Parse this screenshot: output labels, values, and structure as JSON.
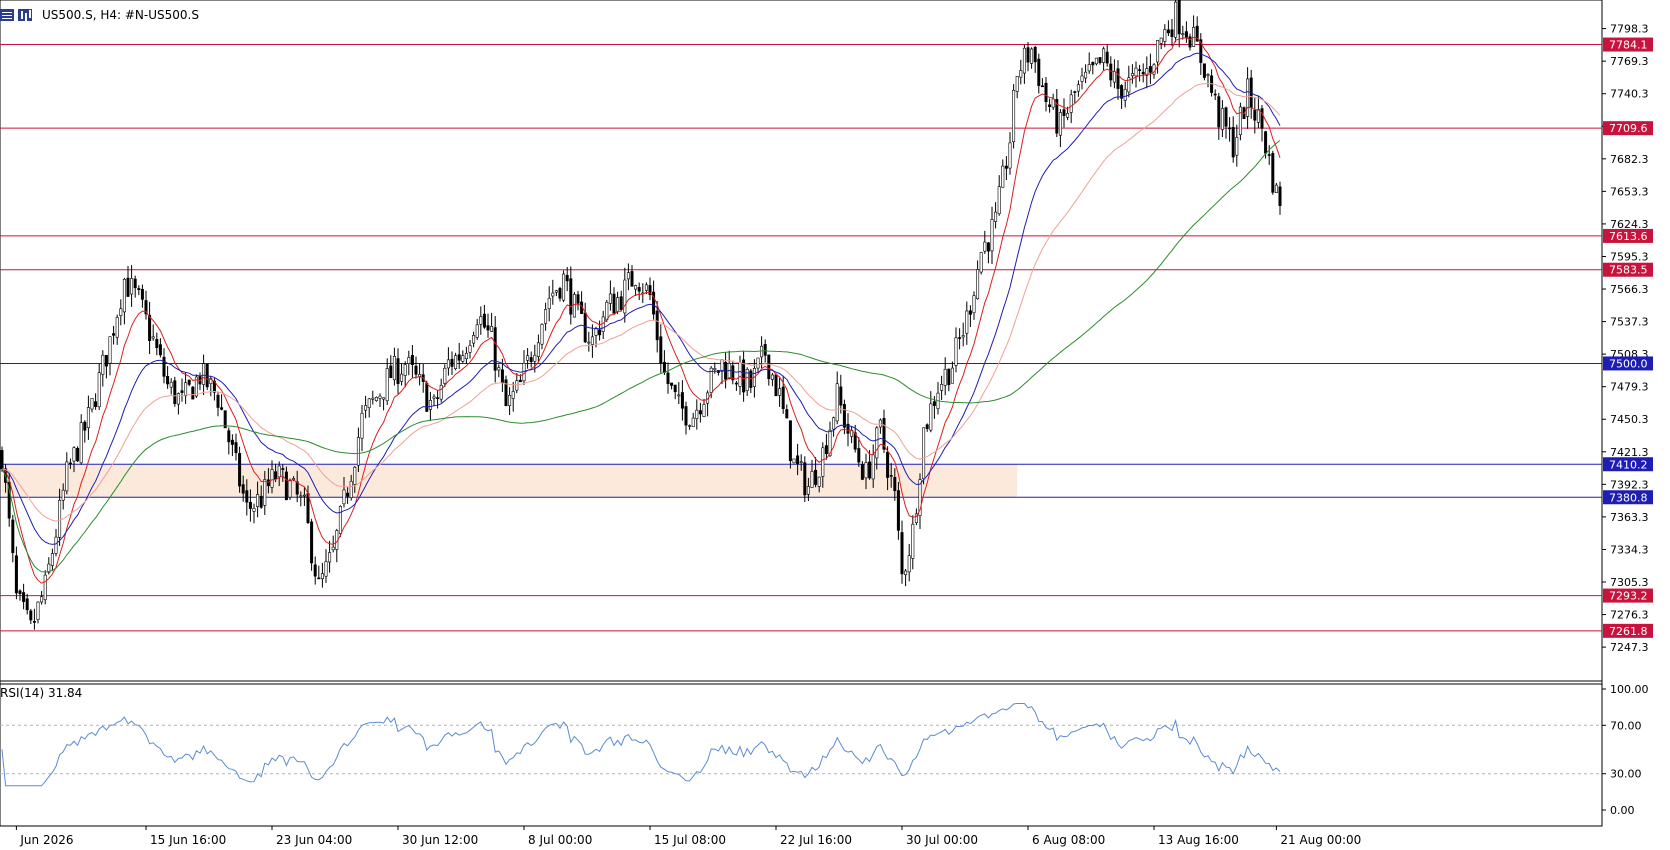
{
  "header": {
    "symbol_line": "US500.S, H4:  #N-US500.S",
    "menu_icon": "menu-grid-icon",
    "chart_icon": "chart-type-icon"
  },
  "colors": {
    "bull_body": "#ffffff",
    "bear_body": "#000000",
    "candle_wick": "#000000",
    "ma_fast": "#dc1e1e",
    "ma_mid": "#1e1eb4",
    "ma_slow": "#f0a096",
    "ma_200": "#2d8c2d",
    "red_level": "#c8143c",
    "blue_level": "#1e1eb4",
    "zone": "#fbeadc",
    "rsi": "#5a8cd2"
  },
  "chart_data": {
    "type": "candlestick",
    "symbol": "US500.S",
    "timeframe": "H4",
    "y_ticks": [
      7798.3,
      7769.3,
      7740.3,
      7711.3,
      7682.3,
      7653.3,
      7624.3,
      7595.3,
      7566.3,
      7537.3,
      7508.3,
      7479.3,
      7450.3,
      7421.3,
      7392.3,
      7363.3,
      7334.3,
      7305.3,
      7276.3,
      7247.3
    ],
    "y_tick_labels": [
      "7798.3",
      "7769.3",
      "7740.3",
      "",
      "7682.3",
      "7653.3",
      "7624.3",
      "7595.3",
      "7566.3",
      "7537.3",
      "7508.3",
      "7479.3",
      "7450.3",
      "7421.3",
      "7392.3",
      "7363.3",
      "7334.3",
      "7305.3",
      "7276.3",
      "7247.3"
    ],
    "ylim": [
      7218,
      7822
    ],
    "x_labels": [
      {
        "text": "Jun 2026",
        "bar": 4
      },
      {
        "text": "15 Jun 16:00",
        "bar": 40
      },
      {
        "text": "23 Jun 04:00",
        "bar": 75
      },
      {
        "text": "30 Jun 12:00",
        "bar": 110
      },
      {
        "text": "8 Jul 00:00",
        "bar": 145
      },
      {
        "text": "15 Jul 08:00",
        "bar": 180
      },
      {
        "text": "22 Jul 16:00",
        "bar": 215
      },
      {
        "text": "30 Jul 00:00",
        "bar": 250
      },
      {
        "text": "6 Aug 08:00",
        "bar": 285
      },
      {
        "text": "13 Aug 16:00",
        "bar": 320
      },
      {
        "text": "21 Aug 00:00",
        "bar": 354
      }
    ],
    "bars_total": 356,
    "levels": [
      {
        "value": 7784.1,
        "label": "7784.1",
        "kind": "red"
      },
      {
        "value": 7709.6,
        "label": "7709.6",
        "kind": "red"
      },
      {
        "value": 7613.6,
        "label": "7613.6",
        "kind": "red"
      },
      {
        "value": 7583.5,
        "label": "7583.5",
        "kind": "red"
      },
      {
        "value": 7500.0,
        "label": "7500.0",
        "kind": "blue"
      },
      {
        "value": 7410.2,
        "label": "7410.2",
        "kind": "blue"
      },
      {
        "value": 7380.8,
        "label": "7380.8",
        "kind": "blue"
      },
      {
        "value": 7293.2,
        "label": "7293.2",
        "kind": "red"
      },
      {
        "value": 7261.8,
        "label": "7261.8",
        "kind": "red"
      }
    ],
    "zone": {
      "from_bar": 0,
      "to_bar": 282,
      "low": 7380.8,
      "high": 7410.2
    },
    "price_path": [
      [
        0,
        7420
      ],
      [
        4,
        7290
      ],
      [
        8,
        7262
      ],
      [
        12,
        7300
      ],
      [
        18,
        7400
      ],
      [
        24,
        7450
      ],
      [
        30,
        7520
      ],
      [
        34,
        7575
      ],
      [
        38,
        7555
      ],
      [
        42,
        7520
      ],
      [
        46,
        7480
      ],
      [
        50,
        7465
      ],
      [
        55,
        7490
      ],
      [
        60,
        7470
      ],
      [
        64,
        7420
      ],
      [
        68,
        7370
      ],
      [
        72,
        7380
      ],
      [
        76,
        7400
      ],
      [
        80,
        7390
      ],
      [
        84,
        7370
      ],
      [
        88,
        7300
      ],
      [
        92,
        7330
      ],
      [
        96,
        7390
      ],
      [
        100,
        7450
      ],
      [
        104,
        7470
      ],
      [
        108,
        7490
      ],
      [
        112,
        7500
      ],
      [
        116,
        7480
      ],
      [
        120,
        7460
      ],
      [
        124,
        7500
      ],
      [
        128,
        7510
      ],
      [
        132,
        7545
      ],
      [
        136,
        7520
      ],
      [
        140,
        7460
      ],
      [
        144,
        7480
      ],
      [
        148,
        7520
      ],
      [
        152,
        7560
      ],
      [
        156,
        7575
      ],
      [
        160,
        7540
      ],
      [
        164,
        7520
      ],
      [
        168,
        7550
      ],
      [
        172,
        7560
      ],
      [
        176,
        7580
      ],
      [
        180,
        7560
      ],
      [
        184,
        7490
      ],
      [
        188,
        7460
      ],
      [
        192,
        7455
      ],
      [
        196,
        7480
      ],
      [
        200,
        7500
      ],
      [
        204,
        7490
      ],
      [
        208,
        7480
      ],
      [
        212,
        7510
      ],
      [
        216,
        7470
      ],
      [
        220,
        7410
      ],
      [
        224,
        7390
      ],
      [
        228,
        7420
      ],
      [
        232,
        7470
      ],
      [
        236,
        7430
      ],
      [
        240,
        7400
      ],
      [
        244,
        7440
      ],
      [
        248,
        7380
      ],
      [
        250,
        7310
      ],
      [
        253,
        7350
      ],
      [
        256,
        7440
      ],
      [
        260,
        7480
      ],
      [
        264,
        7500
      ],
      [
        268,
        7540
      ],
      [
        272,
        7600
      ],
      [
        276,
        7625
      ],
      [
        280,
        7700
      ],
      [
        282,
        7760
      ],
      [
        286,
        7780
      ],
      [
        290,
        7735
      ],
      [
        294,
        7710
      ],
      [
        298,
        7740
      ],
      [
        302,
        7755
      ],
      [
        306,
        7770
      ],
      [
        310,
        7745
      ],
      [
        314,
        7750
      ],
      [
        318,
        7760
      ],
      [
        322,
        7790
      ],
      [
        326,
        7810
      ],
      [
        330,
        7795
      ],
      [
        334,
        7765
      ],
      [
        338,
        7720
      ],
      [
        342,
        7695
      ],
      [
        346,
        7740
      ],
      [
        350,
        7710
      ],
      [
        352,
        7680
      ],
      [
        354,
        7650
      ],
      [
        355,
        7648
      ]
    ],
    "rsi": {
      "period": 14,
      "label": "RSI(14) 31.84",
      "ylim": [
        0,
        100
      ],
      "ticks": [
        "100.00",
        "70.00",
        "30.00",
        "0.00"
      ],
      "tick_values": [
        100,
        70,
        30,
        0
      ],
      "levels": [
        70,
        30
      ]
    }
  }
}
